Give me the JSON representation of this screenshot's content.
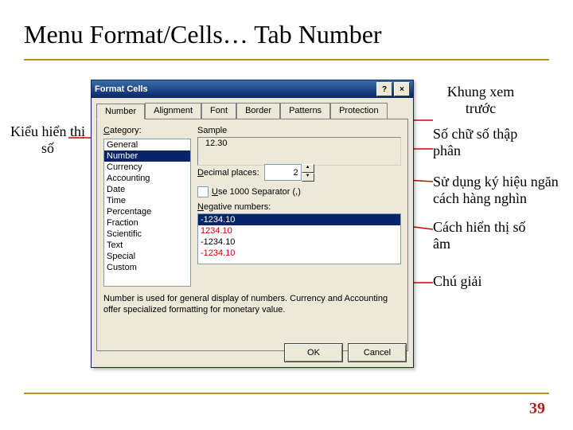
{
  "title": "Menu Format/Cells… Tab Number",
  "page_number": "39",
  "annotations": {
    "category": "Kiểu hiển thị số",
    "sample": "Khung xem trước",
    "decimal": "Số chữ số thập phân",
    "separator": "Sử dụng ký hiệu ngăn cách hàng nghìn",
    "negative": "Cách hiển thị số âm",
    "desc": "Chú giải"
  },
  "dialog": {
    "title": "Format Cells",
    "help_btn": "?",
    "close_btn": "×",
    "tabs": [
      "Number",
      "Alignment",
      "Font",
      "Border",
      "Patterns",
      "Protection"
    ],
    "category_label": "Category:",
    "categories": [
      "General",
      "Number",
      "Currency",
      "Accounting",
      "Date",
      "Time",
      "Percentage",
      "Fraction",
      "Scientific",
      "Text",
      "Special",
      "Custom"
    ],
    "selected_category_index": 1,
    "sample_label": "Sample",
    "sample_value": "12.30",
    "decimal_label": "Decimal places:",
    "decimal_value": "2",
    "separator_label": "Use 1000 Separator (,)",
    "negative_label": "Negative numbers:",
    "negative_numbers": [
      "-1234.10",
      "1234.10",
      "-1234.10",
      "-1234.10"
    ],
    "neg_selected_index": 0,
    "desc": "Number is used for general display of numbers.  Currency and Accounting offer specialized formatting for monetary value.",
    "ok": "OK",
    "cancel": "Cancel"
  }
}
